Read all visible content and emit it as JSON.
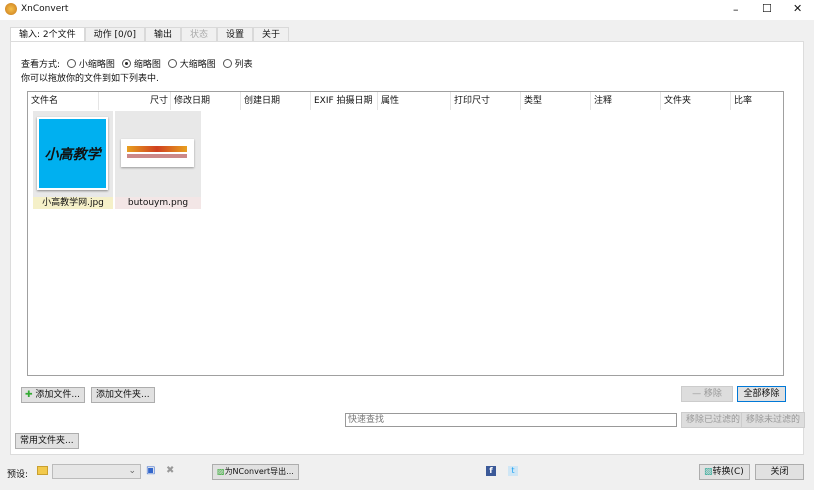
{
  "window": {
    "title": "XnConvert",
    "minimize": "–",
    "maximize": "☐",
    "close": "✕"
  },
  "tabs": [
    {
      "label": "输入: 2个文件"
    },
    {
      "label": "动作 [0/0]"
    },
    {
      "label": "输出"
    },
    {
      "label": "状态"
    },
    {
      "label": "设置"
    },
    {
      "label": "关于"
    }
  ],
  "view": {
    "label": "查看方式:",
    "options": [
      "小缩略图",
      "缩略图",
      "大缩略图",
      "列表"
    ],
    "selected": "缩略图",
    "hint": "你可以拖放你的文件到如下列表中."
  },
  "columns": [
    "文件名",
    "尺寸",
    "修改日期",
    "创建日期",
    "EXIF 拍摄日期",
    "属性",
    "打印尺寸",
    "类型",
    "注释",
    "文件夹",
    "比率"
  ],
  "files": [
    {
      "name": "小高教学网.jpg",
      "thumb_text": "小高教学网"
    },
    {
      "name": "butouym.png"
    }
  ],
  "buttons": {
    "add_files": "添加文件...",
    "add_folder": "添加文件夹...",
    "remove": "— 移除",
    "remove_all": "全部移除",
    "remove_filtered": "移除已过滤的",
    "remove_unfiltered": "移除未过滤的",
    "common_folders": "常用文件夹...",
    "export": "为NConvert导出...",
    "convert": "转换(C)",
    "close": "关闭"
  },
  "search": {
    "placeholder": "快速查找"
  },
  "preset": {
    "label": "预设:",
    "value": ""
  },
  "colors": {
    "accent": "#0078d7",
    "thumb_bg": "#00b0f0"
  }
}
